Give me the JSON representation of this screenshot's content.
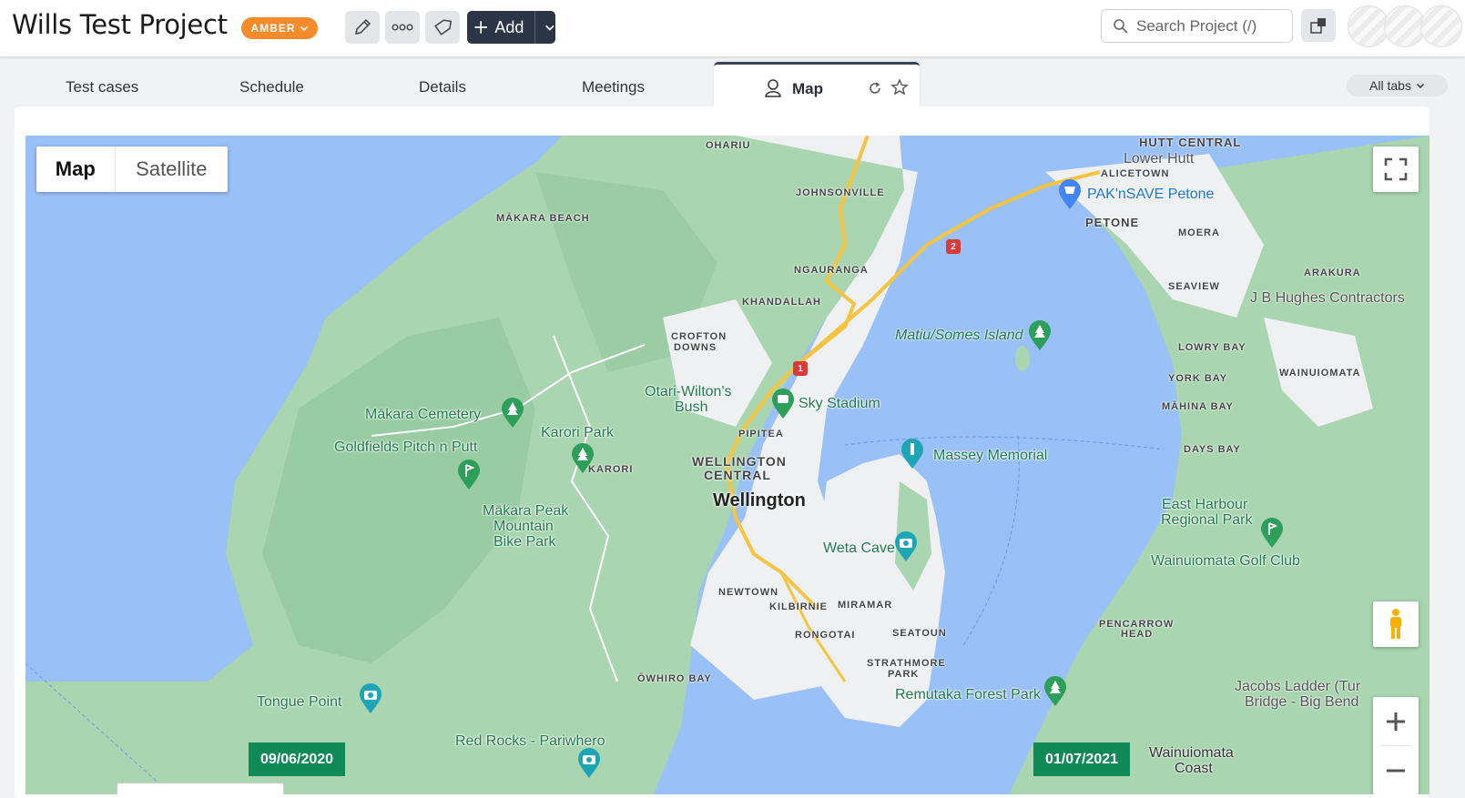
{
  "header": {
    "project_title": "Wills Test Project",
    "status_badge": "AMBER",
    "add_label": "Add",
    "search_placeholder": "Search Project (/)"
  },
  "tabs": {
    "items": [
      "Test cases",
      "Schedule",
      "Details",
      "Meetings"
    ],
    "active": "Map",
    "all_tabs_label": "All tabs"
  },
  "map": {
    "type_options": [
      "Map",
      "Satellite"
    ],
    "selected_type": "Map",
    "places": [
      "OHARIU",
      "JOHNSONVILLE",
      "MĀKARA BEACH",
      "NGAURANGA",
      "KHANDALLAH",
      "CROFTON",
      "DOWNS",
      "PIPITEA",
      "WELLINGTON",
      "CENTRAL",
      "KARORI",
      "NEWTOWN",
      "KILBIRNIE",
      "MIRAMAR",
      "RONGOTAI",
      "SEATOUN",
      "STRATHMORE",
      "PARK",
      "ŌWHIRO BAY",
      "HUTT CENTRAL",
      "ALICETOWN",
      "PETONE",
      "MOERA",
      "SEAVIEW",
      "ARAKURA",
      "LOWRY BAY",
      "YORK BAY",
      "WAINUIOMATA",
      "MĀHINA BAY",
      "DAYS BAY",
      "PENCARROW",
      "HEAD"
    ],
    "city_label": "Wellington",
    "town_label": "Lower Hutt",
    "pois": {
      "makara_cemetery": "Mākara Cemetery",
      "goldfields": "Goldfields Pitch n Putt",
      "karori_park": "Karori Park",
      "otari_1": "Otari-Wilton's",
      "otari_2": "Bush",
      "makara_peak_1": "Mākara Peak",
      "makara_peak_2": "Mountain",
      "makara_peak_3": "Bike Park",
      "sky_stadium": "Sky Stadium",
      "massey_memorial": "Massey Memorial",
      "weta_cave": "Weta Cave",
      "matiu_island": "Matiu/Somes Island",
      "tongue_point": "Tongue Point",
      "red_rocks": "Red Rocks - Pariwhero",
      "remutaka": "Remutaka Forest Park",
      "east_harbour_1": "East Harbour",
      "east_harbour_2": "Regional Park",
      "wainuiomata_golf": "Wainuiomata Golf Club",
      "pak_n_save": "PAK'nSAVE Petone",
      "jb_hughes": "J B Hughes Contractors",
      "jacobs_1": "Jacobs Ladder (Tur",
      "jacobs_2": "Bridge - Big Bend",
      "wainuiomata_coast_1": "Wainuiomata",
      "wainuiomata_coast_2": "Coast"
    },
    "route_shields": [
      "2",
      "1"
    ],
    "date_start": "09/06/2020",
    "date_end": "01/07/2021"
  },
  "colors": {
    "badge": "#f58b2a",
    "add_button": "#2b3546",
    "water": "#99c0f7",
    "land": "#a9d5b0",
    "urban": "#eef0f2",
    "date_badge": "#0f8a57"
  }
}
